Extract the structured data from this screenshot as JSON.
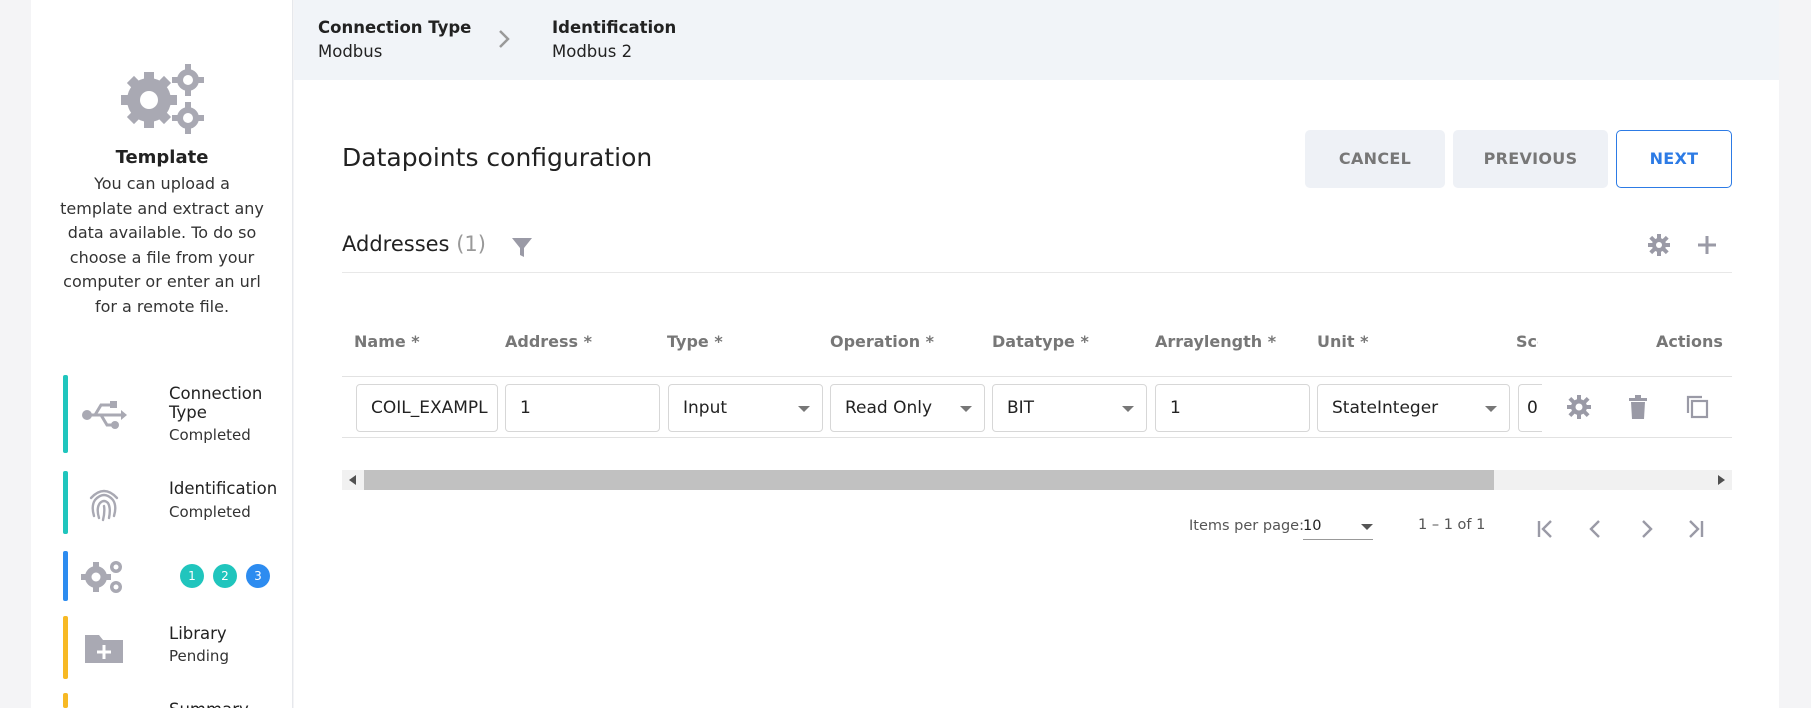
{
  "sidebar": {
    "template": {
      "title": "Template",
      "description": "You can upload a template and extract any data available. To do so choose a file from your computer or enter an url for a remote file."
    },
    "steps": [
      {
        "title": "Connection Type",
        "status": "Completed",
        "icon": "usb-icon",
        "color": "#20c5bd"
      },
      {
        "title": "Identification",
        "status": "Completed",
        "icon": "fingerprint-icon",
        "color": "#20c5bd"
      },
      {
        "title": "",
        "status": "",
        "icon": "gears-icon",
        "color": "#2d8cf0",
        "substeps": [
          "1",
          "2",
          "3"
        ]
      },
      {
        "title": "Library",
        "status": "Pending",
        "icon": "folder-plus-icon",
        "color": "#f7b924"
      },
      {
        "title": "Summary",
        "status": "",
        "icon": "summary-icon",
        "color": "#f7b924"
      }
    ]
  },
  "breadcrumb": {
    "items": [
      {
        "title": "Connection Type",
        "value": "Modbus"
      },
      {
        "title": "Identification",
        "value": "Modbus 2"
      }
    ]
  },
  "page": {
    "title": "Datapoints configuration",
    "buttons": {
      "cancel": "CANCEL",
      "previous": "PREVIOUS",
      "next": "NEXT"
    }
  },
  "addresses": {
    "title": "Addresses",
    "count": "(1)",
    "columns": [
      "Name *",
      "Address *",
      "Type *",
      "Operation *",
      "Datatype *",
      "Arraylength *",
      "Unit *",
      "Scc",
      "Actions"
    ],
    "rows": [
      {
        "name": "COIL_EXAMPL",
        "address": "1",
        "type": "Input",
        "operation": "Read Only",
        "datatype": "BIT",
        "arraylength": "1",
        "unit": "StateInteger",
        "scale": "0"
      }
    ]
  },
  "paginator": {
    "items_per_page_label": "Items per page:",
    "items_per_page": "10",
    "range": "1 – 1 of 1"
  },
  "colors": {
    "accent_blue": "#2d7be5",
    "teal": "#20c5bd",
    "step_blue": "#2d8cf0",
    "amber": "#f7b924",
    "icon_grey": "#9a9aa6"
  }
}
